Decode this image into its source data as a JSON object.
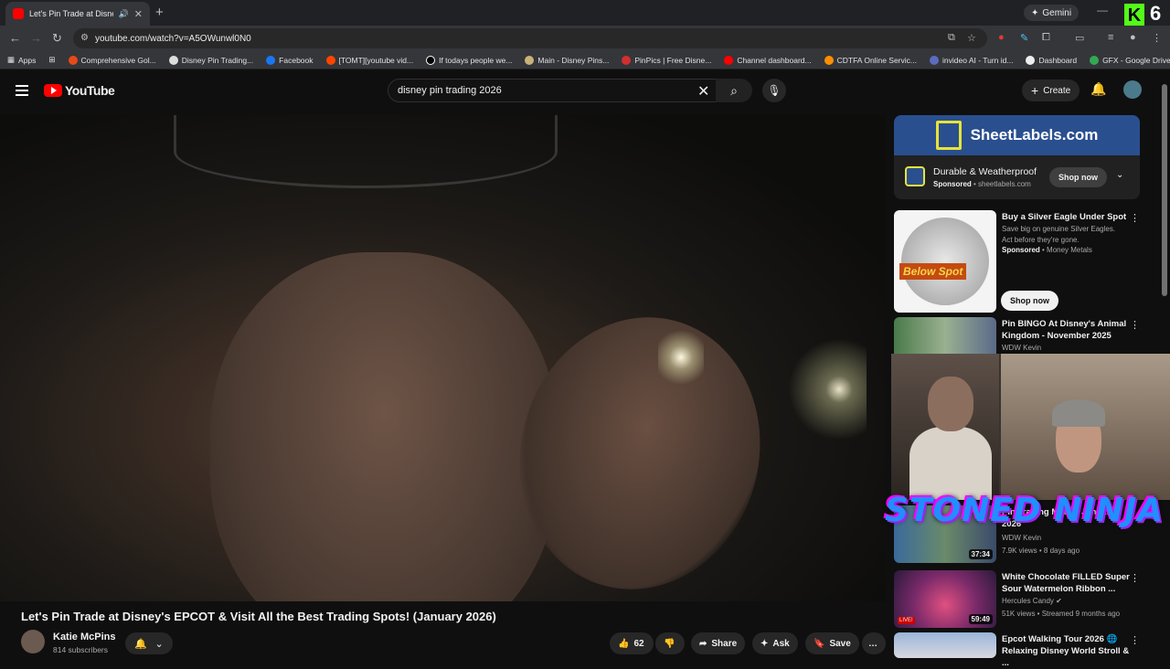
{
  "browser": {
    "tab_title": "Let's Pin Trade at Disney's E",
    "url": "youtube.com/watch?v=A5OWunwl0N0",
    "gemini_label": "Gemini",
    "kick_letter": "K",
    "kick_number": "6",
    "bookmarks": [
      "Apps",
      "Comprehensive Gol...",
      "Disney Pin Trading...",
      "Facebook",
      "[TOMT][youtube vid...",
      "If todays people we...",
      "Main - Disney Pins...",
      "PinPics | Free Disne...",
      "Channel dashboard...",
      "CDTFA Online Servic...",
      "invideo AI - Turn id...",
      "Dashboard",
      "GFX - Google Drive"
    ]
  },
  "youtube": {
    "logo_text": "YouTube",
    "search_value": "disney pin trading 2026",
    "create_label": "Create"
  },
  "video": {
    "title": "Let's Pin Trade at Disney's EPCOT & Visit All the Best Trading Spots! (January 2026)",
    "channel": "Katie McPins",
    "subscribers": "814 subscribers",
    "likes": "62",
    "share_label": "Share",
    "ask_label": "Ask",
    "save_label": "Save"
  },
  "ad": {
    "brand": "SheetLabels.com",
    "headline": "Durable & Weatherproof",
    "sponsored": "Sponsored",
    "domain": "sheetlabels.com",
    "cta": "Shop now"
  },
  "recommendations": [
    {
      "title": "Buy a Silver Eagle Under Spot",
      "desc": "Save big on genuine Silver Eagles. Act before they're gone.",
      "sponsored": "Sponsored",
      "advertiser": "Money Metals",
      "cta": "Shop now",
      "thumb_text": "Below Spot"
    },
    {
      "title": "Pin BINGO At Disney's Animal Kingdom - November 2025",
      "channel": "WDW Kevin"
    },
    {
      "title_partial": "Pin Trading Mat... - January 2026",
      "channel": "WDW Kevin",
      "meta": "7.9K views • 8 days ago",
      "duration": "37:34"
    },
    {
      "title": "White Chocolate FILLED Super Sour Watermelon Ribbon ...",
      "channel": "Hercules Candy",
      "meta": "51K views • Streamed 9 months ago",
      "duration": "59:49",
      "badge": "LIVE!"
    },
    {
      "title": "Epcot Walking Tour 2026 🌐 Relaxing Disney World Stroll & ..."
    }
  ],
  "overlay": {
    "text": "STONED NINJA"
  }
}
